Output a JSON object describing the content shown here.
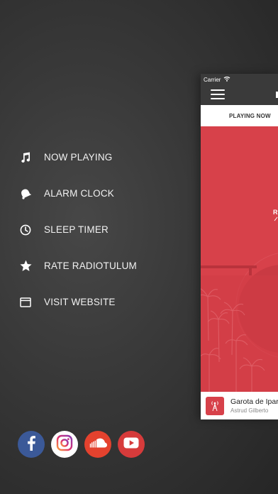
{
  "menu": {
    "items": [
      {
        "label": "NOW PLAYING",
        "icon": "music-note-icon"
      },
      {
        "label": "ALARM CLOCK",
        "icon": "alarm-bell-icon"
      },
      {
        "label": "SLEEP TIMER",
        "icon": "clock-icon"
      },
      {
        "label": "RATE RADIOTULUM",
        "icon": "star-icon"
      },
      {
        "label": "VISIT WEBSITE",
        "icon": "browser-window-icon"
      }
    ]
  },
  "social": [
    {
      "name": "facebook",
      "icon": "facebook-icon",
      "color": "#3b5998"
    },
    {
      "name": "instagram",
      "icon": "instagram-icon",
      "color": "#ffffff"
    },
    {
      "name": "soundcloud",
      "icon": "soundcloud-icon",
      "color": "#e4422e"
    },
    {
      "name": "youtube",
      "icon": "youtube-icon",
      "color": "#d63b3b"
    }
  ],
  "panel": {
    "carrier": "Carrier",
    "tab_now_playing": "PLAYING NOW",
    "track_title": "Garota de Ipar",
    "track_artist": "Astrud Gilberto"
  },
  "colors": {
    "accent": "#d7414a",
    "nav_bar": "#3a3a3a"
  }
}
